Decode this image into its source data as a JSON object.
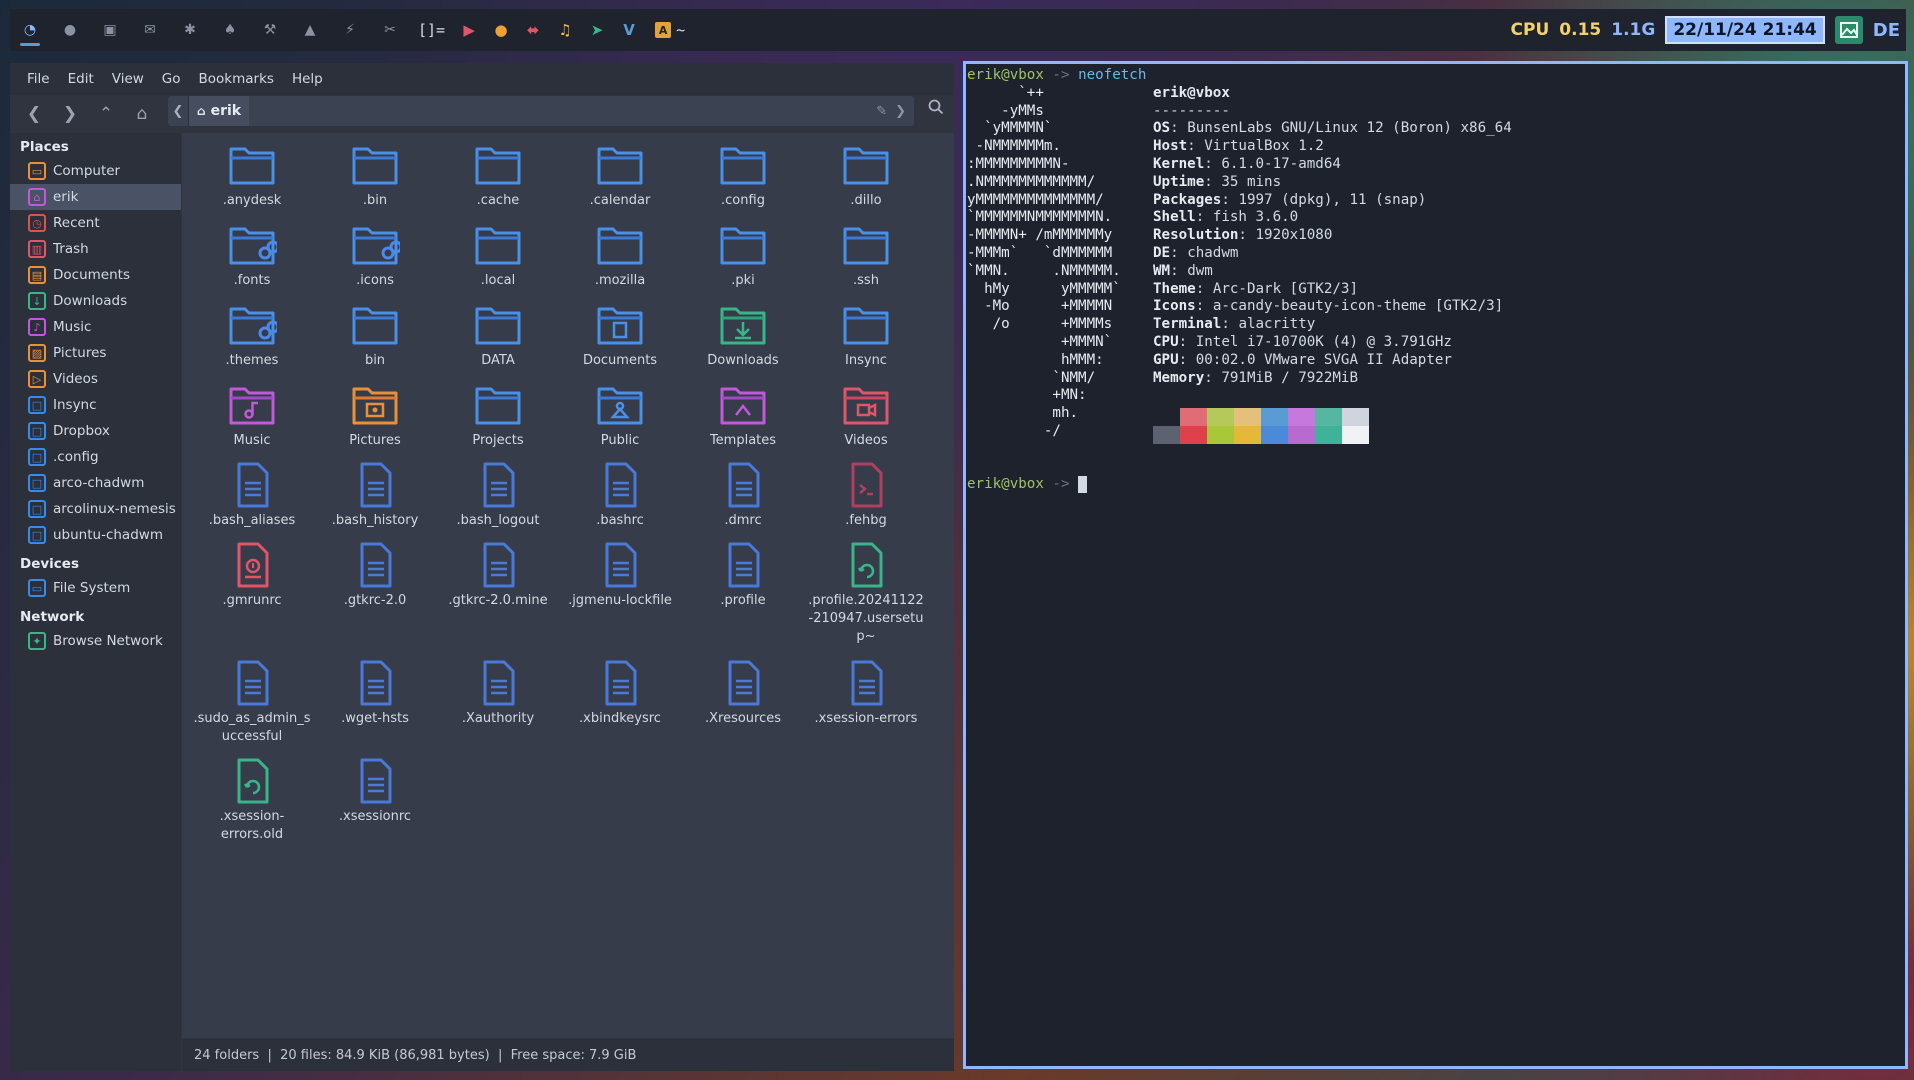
{
  "topbar": {
    "tags": [
      "debian-icon",
      "firefox-icon",
      "inbox-icon",
      "mail-icon",
      "settings-icon",
      "trophy-icon",
      "wrench-icon",
      "drop-icon",
      "bolt-icon",
      "paperclip-icon"
    ],
    "layout_symbol": "[]=",
    "app_icons": [
      "youtube-icon",
      "firefox-orange-icon",
      "usb-icon",
      "music-icon",
      "send-icon",
      "vivaldi-icon"
    ],
    "title_glyph": "~",
    "cpu_label": "CPU",
    "cpu_value": "0.15",
    "mem_value": "1.1G",
    "clock": "22/11/24 21:44",
    "de_label": "DE"
  },
  "filemanager": {
    "menu": [
      "File",
      "Edit",
      "View",
      "Go",
      "Bookmarks",
      "Help"
    ],
    "path": "erik",
    "sidebar": {
      "places_title": "Places",
      "places": [
        {
          "label": "Computer",
          "icon": "computer-icon",
          "color": "#e8903a"
        },
        {
          "label": "erik",
          "icon": "home-icon",
          "color": "#c05ad8",
          "selected": true
        },
        {
          "label": "Recent",
          "icon": "clock-icon",
          "color": "#d9534f"
        },
        {
          "label": "Trash",
          "icon": "trash-icon",
          "color": "#e0556a"
        },
        {
          "label": "Documents",
          "icon": "documents-icon",
          "color": "#e8903a"
        },
        {
          "label": "Downloads",
          "icon": "downloads-icon",
          "color": "#3ab58a"
        },
        {
          "label": "Music",
          "icon": "music-icon",
          "color": "#c05ad8"
        },
        {
          "label": "Pictures",
          "icon": "pictures-icon",
          "color": "#e8903a"
        },
        {
          "label": "Videos",
          "icon": "videos-icon",
          "color": "#e8903a"
        },
        {
          "label": "Insync",
          "icon": "folder-icon",
          "color": "#3a8ae8"
        },
        {
          "label": "Dropbox",
          "icon": "folder-icon",
          "color": "#3a8ae8"
        },
        {
          "label": ".config",
          "icon": "folder-icon",
          "color": "#3a8ae8"
        },
        {
          "label": "arco-chadwm",
          "icon": "folder-icon",
          "color": "#3a8ae8"
        },
        {
          "label": "arcolinux-nemesis",
          "icon": "folder-icon",
          "color": "#3a8ae8"
        },
        {
          "label": "ubuntu-chadwm",
          "icon": "folder-icon",
          "color": "#3a8ae8"
        }
      ],
      "devices_title": "Devices",
      "devices": [
        {
          "label": "File System",
          "icon": "drive-icon",
          "color": "#3a8ae8"
        }
      ],
      "network_title": "Network",
      "network": [
        {
          "label": "Browse Network",
          "icon": "network-icon",
          "color": "#3ab58a"
        }
      ]
    },
    "items": [
      {
        "label": ".anydesk",
        "kind": "folder"
      },
      {
        "label": ".bin",
        "kind": "folder"
      },
      {
        "label": ".cache",
        "kind": "folder"
      },
      {
        "label": ".calendar",
        "kind": "folder"
      },
      {
        "label": ".config",
        "kind": "folder"
      },
      {
        "label": ".dillo",
        "kind": "folder"
      },
      {
        "label": ".fonts",
        "kind": "folder-link"
      },
      {
        "label": ".icons",
        "kind": "folder-link"
      },
      {
        "label": ".local",
        "kind": "folder"
      },
      {
        "label": ".mozilla",
        "kind": "folder"
      },
      {
        "label": ".pki",
        "kind": "folder"
      },
      {
        "label": ".ssh",
        "kind": "folder"
      },
      {
        "label": ".themes",
        "kind": "folder-link"
      },
      {
        "label": "bin",
        "kind": "folder"
      },
      {
        "label": "DATA",
        "kind": "folder"
      },
      {
        "label": "Documents",
        "kind": "folder-documents"
      },
      {
        "label": "Downloads",
        "kind": "folder-downloads"
      },
      {
        "label": "Insync",
        "kind": "folder"
      },
      {
        "label": "Music",
        "kind": "folder-music"
      },
      {
        "label": "Pictures",
        "kind": "folder-pictures"
      },
      {
        "label": "Projects",
        "kind": "folder"
      },
      {
        "label": "Public",
        "kind": "folder-public"
      },
      {
        "label": "Templates",
        "kind": "folder-templates"
      },
      {
        "label": "Videos",
        "kind": "folder-videos"
      },
      {
        "label": ".bash_aliases",
        "kind": "text"
      },
      {
        "label": ".bash_history",
        "kind": "text"
      },
      {
        "label": ".bash_logout",
        "kind": "text"
      },
      {
        "label": ".bashrc",
        "kind": "text"
      },
      {
        "label": ".dmrc",
        "kind": "text"
      },
      {
        "label": ".fehbg",
        "kind": "script"
      },
      {
        "label": ".gmrunrc",
        "kind": "config-red"
      },
      {
        "label": ".gtkrc-2.0",
        "kind": "text"
      },
      {
        "label": ".gtkrc-2.0.mine",
        "kind": "text"
      },
      {
        "label": ".jgmenu-lockfile",
        "kind": "text"
      },
      {
        "label": ".profile",
        "kind": "text"
      },
      {
        "label": ".profile.20241122-210947.usersetup~",
        "kind": "backup"
      },
      {
        "label": ".sudo_as_admin_successful",
        "kind": "text"
      },
      {
        "label": ".wget-hsts",
        "kind": "text"
      },
      {
        "label": ".Xauthority",
        "kind": "text"
      },
      {
        "label": ".xbindkeysrc",
        "kind": "text"
      },
      {
        "label": ".Xresources",
        "kind": "text"
      },
      {
        "label": ".xsession-errors",
        "kind": "text"
      },
      {
        "label": ".xsession-errors.old",
        "kind": "backup"
      },
      {
        "label": ".xsessionrc",
        "kind": "text"
      }
    ],
    "status": "24 folders  |  20 files: 84.9 KiB (86,981 bytes)  |  Free space: 7.9 GiB"
  },
  "terminal": {
    "prompt_user": "erik@vbox",
    "prompt_arrow": "->",
    "command": "neofetch",
    "ascii": [
      "      `++",
      "    -yMMs",
      "  `yMMMMN`",
      " -NMMMMMMm.",
      ":MMMMMMMMMN-",
      ".NMMMMMMMMMMMM/",
      "yMMMMMMMMMMMMMM/",
      "`MMMMMMNMMMMMMMN.",
      "-MMMMN+ /mMMMMMMy",
      "-MMMm`   `dMMMMMM",
      "`MMN.     .NMMMMM.",
      "  hMy      yMMMMM`",
      "  -Mo      +MMMMN",
      "   /o      +MMMMs",
      "           +MMMN`",
      "           hMMM:",
      "          `NMM/",
      "          +MN:",
      "          mh.",
      "         -/"
    ],
    "title": "erik@vbox",
    "separator": "---------",
    "info": [
      {
        "key": "OS",
        "value": "BunsenLabs GNU/Linux 12 (Boron) x86_64"
      },
      {
        "key": "Host",
        "value": "VirtualBox 1.2"
      },
      {
        "key": "Kernel",
        "value": "6.1.0-17-amd64"
      },
      {
        "key": "Uptime",
        "value": "35 mins"
      },
      {
        "key": "Packages",
        "value": "1997 (dpkg), 11 (snap)"
      },
      {
        "key": "Shell",
        "value": "fish 3.6.0"
      },
      {
        "key": "Resolution",
        "value": "1920x1080"
      },
      {
        "key": "DE",
        "value": "chadwm"
      },
      {
        "key": "WM",
        "value": "dwm"
      },
      {
        "key": "Theme",
        "value": "Arc-Dark [GTK2/3]"
      },
      {
        "key": "Icons",
        "value": "a-candy-beauty-icon-theme [GTK2/3]"
      },
      {
        "key": "Terminal",
        "value": "alacritty"
      },
      {
        "key": "CPU",
        "value": "Intel i7-10700K (4) @ 3.791GHz"
      },
      {
        "key": "GPU",
        "value": "00:02.0 VMware SVGA II Adapter"
      },
      {
        "key": "Memory",
        "value": "791MiB / 7922MiB"
      }
    ],
    "palette_top": [
      "#1e222c",
      "#e06c75",
      "#b5c95a",
      "#e5c07b",
      "#5b9bd5",
      "#c678dd",
      "#56b6a2",
      "#d0d4dc"
    ],
    "palette_bottom": [
      "#5c6370",
      "#e0404a",
      "#a8c83a",
      "#e5b83a",
      "#4a8ad8",
      "#b86ad0",
      "#3fb39a",
      "#f0f2f5"
    ]
  }
}
